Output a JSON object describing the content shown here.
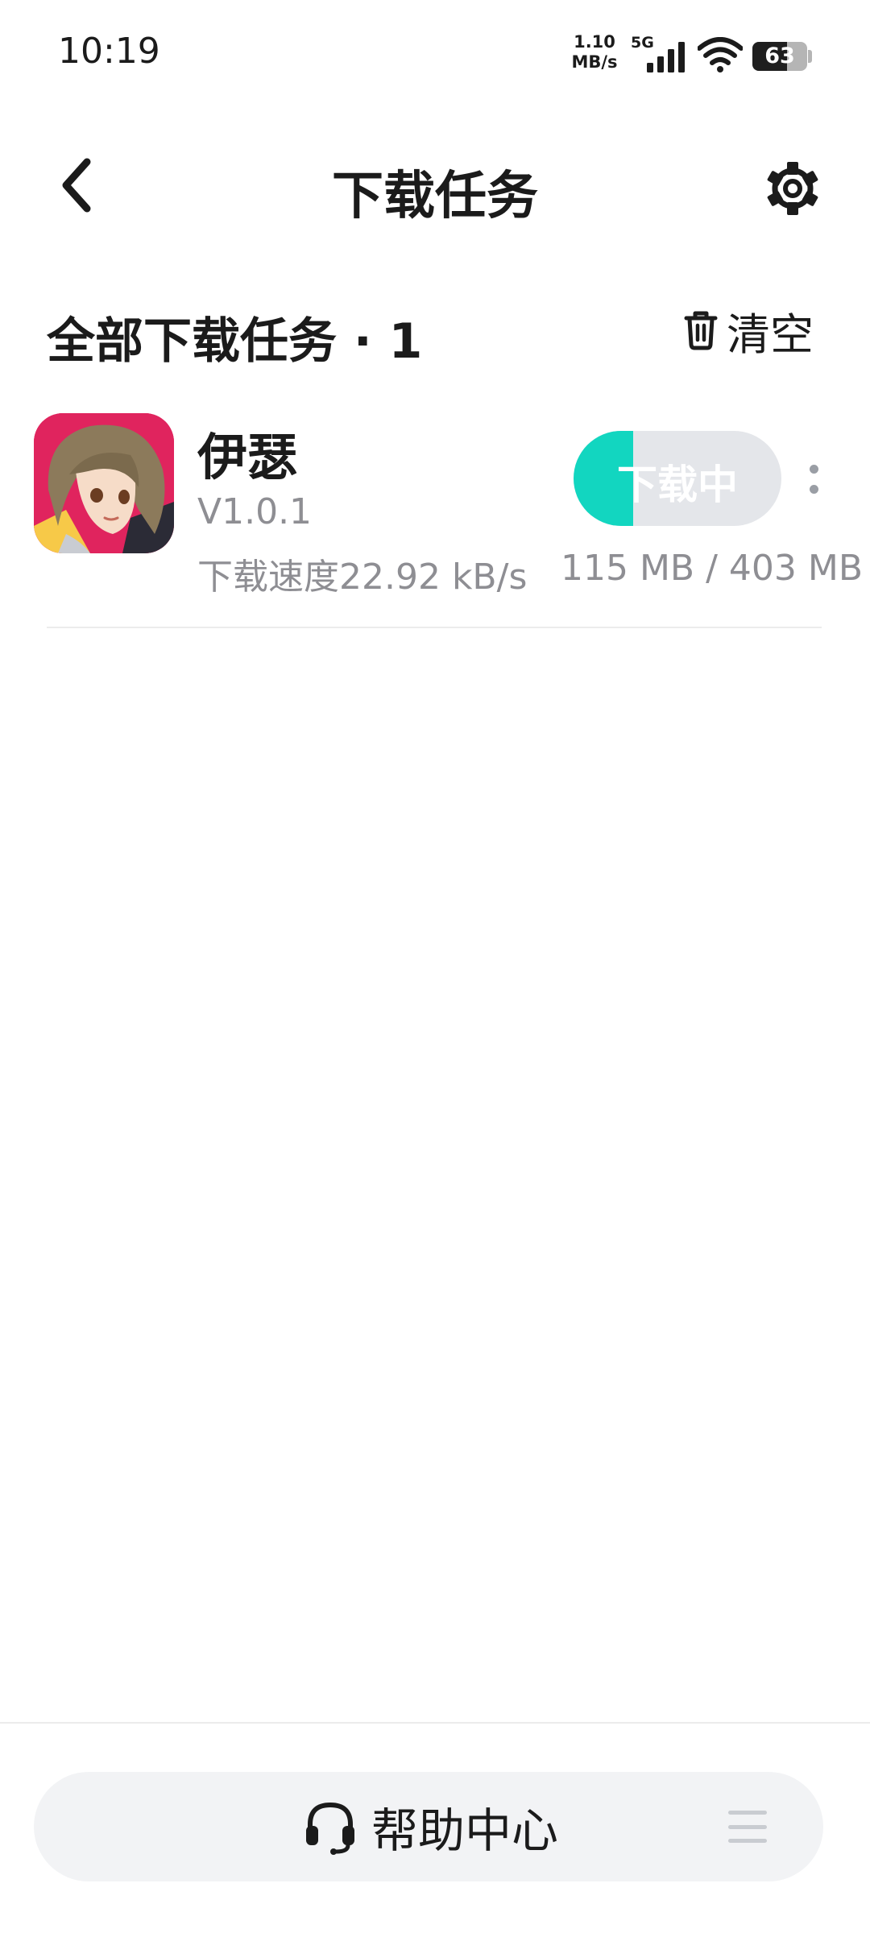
{
  "status_bar": {
    "time": "10:19",
    "net_speed_value": "1.10",
    "net_speed_unit": "MB/s",
    "network_type": "5G",
    "battery_level": 63,
    "battery_text": "63"
  },
  "header": {
    "title": "下载任务",
    "back_icon": "chevron-left-icon",
    "settings_icon": "gear-icon"
  },
  "section": {
    "title": "全部下载任务 · 1",
    "clear_label": "清空",
    "clear_icon": "trash-icon"
  },
  "downloads": [
    {
      "name": "伊瑟",
      "version": "V1.0.1",
      "speed": "下载速度22.92 kB/s",
      "size": "115 MB / 403 MB",
      "status_label": "下载中",
      "progress_fraction": 0.285,
      "icon": "app-icon-anime-girl",
      "more_icon": "more-vertical-icon"
    }
  ],
  "footer": {
    "help_label": "帮助中心",
    "help_icon": "headset-icon",
    "menu_icon": "menu-icon"
  },
  "colors": {
    "accent": "#12d6c0",
    "progress_track": "#e4e6ea",
    "secondary_text": "#8e8e93",
    "help_bar_bg": "#f2f3f5"
  }
}
